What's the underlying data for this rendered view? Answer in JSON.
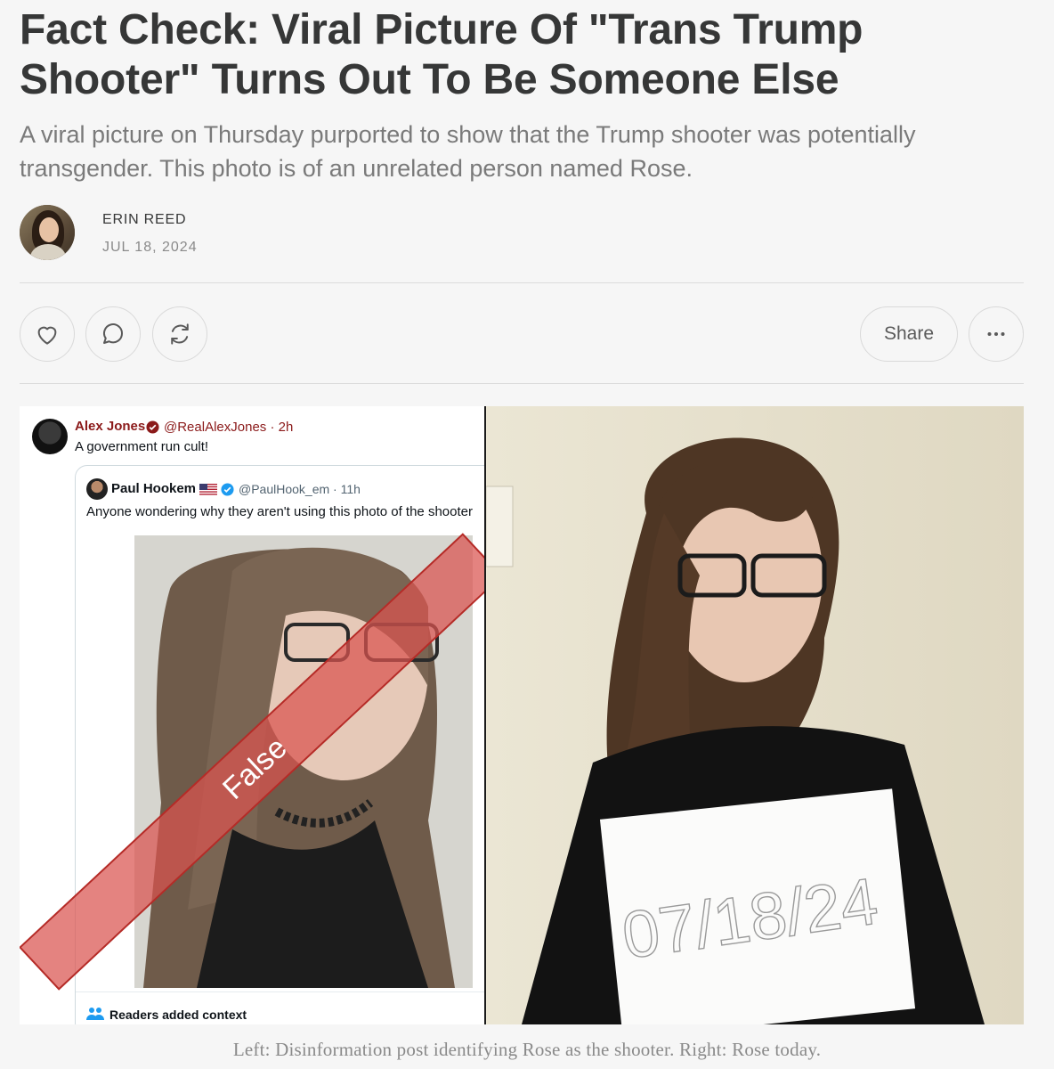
{
  "article": {
    "title": "Fact Check: Viral Picture Of \"Trans Trump Shooter\" Turns Out To Be Someone Else",
    "subtitle": "A viral picture on Thursday purported to show that the Trump shooter was potentially transgender. This photo is of an unrelated person named Rose.",
    "author": "ERIN REED",
    "date": "JUL 18, 2024"
  },
  "actions": {
    "like_icon": "heart-icon",
    "comment_icon": "comment-icon",
    "restack_icon": "restack-icon",
    "share_label": "Share",
    "more_icon": "more-icon"
  },
  "figure": {
    "tweet": {
      "name": "Alex Jones",
      "handle": "@RealAlexJones · 2h",
      "text": "A government run cult!"
    },
    "quoted_tweet": {
      "name": "Paul Hookem",
      "handle": "@PaulHook_em · 11h",
      "text": "Anyone wondering why they aren't using this photo of the shooter",
      "footer": "Readers added context"
    },
    "stamp_text": "False",
    "sign_text": "07/18/24",
    "caption": "Left: Disinformation post identifying Rose as the shooter. Right: Rose today."
  },
  "colors": {
    "background": "#f6f6f6",
    "title": "#363737",
    "subtitle": "#7a7a7a",
    "stamp": "#d9534f",
    "verified": "#1d9bf0"
  }
}
